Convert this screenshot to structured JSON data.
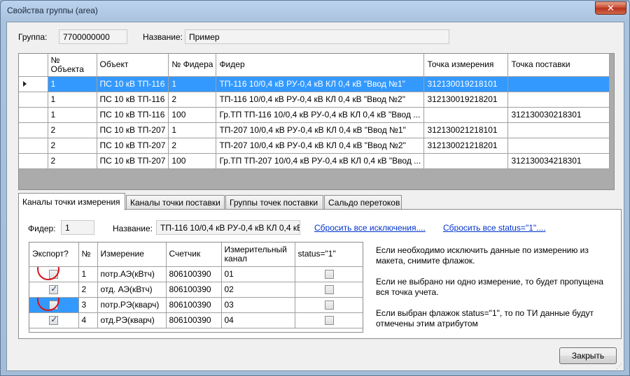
{
  "window": {
    "title": "Свойства группы (area)",
    "close_glyph": "✕"
  },
  "group": {
    "group_label": "Группа:",
    "group_value": "7700000000",
    "name_label": "Название:",
    "name_value": "Пример"
  },
  "main_table": {
    "columns": [
      "№ Объекта",
      "Объект",
      "№ Фидера",
      "Фидер",
      "Точка измерения",
      "Точка поставки"
    ],
    "rows": [
      {
        "n": "1",
        "obj": "ПС 10 кВ ТП-116",
        "fn": "1",
        "feeder": "ТП-116 10/0,4 кВ РУ-0,4 кВ КЛ 0,4 кВ \"Ввод №1\"",
        "tp": "312130019218101",
        "tsp": "",
        "selected": true
      },
      {
        "n": "1",
        "obj": "ПС 10 кВ ТП-116",
        "fn": "2",
        "feeder": "ТП-116 10/0,4 кВ РУ-0,4 кВ КЛ 0,4 кВ \"Ввод №2\"",
        "tp": "312130019218201",
        "tsp": ""
      },
      {
        "n": "1",
        "obj": "ПС 10 кВ ТП-116",
        "fn": "100",
        "feeder": "Гр.ТП ТП-116 10/0,4 кВ РУ-0,4 кВ КЛ 0,4 кВ \"Ввод ...",
        "tp": "",
        "tsp": "312130030218301"
      },
      {
        "n": "2",
        "obj": "ПС 10 кВ ТП-207",
        "fn": "1",
        "feeder": "ТП-207 10/0,4 кВ РУ-0,4 кВ КЛ 0,4 кВ \"Ввод №1\"",
        "tp": "312130021218101",
        "tsp": ""
      },
      {
        "n": "2",
        "obj": "ПС 10 кВ ТП-207",
        "fn": "2",
        "feeder": "ТП-207 10/0,4 кВ РУ-0,4 кВ КЛ 0,4 кВ \"Ввод №2\"",
        "tp": "312130021218201",
        "tsp": ""
      },
      {
        "n": "2",
        "obj": "ПС 10 кВ ТП-207",
        "fn": "100",
        "feeder": "Гр.ТП ТП-207 10/0,4 кВ РУ-0,4 кВ КЛ 0,4 кВ \"Ввод ...",
        "tp": "",
        "tsp": "312130034218301"
      }
    ]
  },
  "tabs": [
    "Каналы точки измерения",
    "Каналы точки поставки",
    "Группы точек поставки",
    "Сальдо перетоков"
  ],
  "tab_panel": {
    "feeder_label": "Фидер:",
    "feeder_value": "1",
    "name_label": "Название:",
    "name_value": "ТП-116 10/0,4 кВ РУ-0,4 кВ КЛ 0,4 кВ",
    "reset_exclusions": "Сбросить все исключения....",
    "reset_status": "Сбросить все status=\"1\"....",
    "channels_columns": [
      "Экспорт?",
      "№",
      "Измерение",
      "Счетчик",
      "Измерительный канал",
      "status=\"1\""
    ],
    "channels": [
      {
        "export": false,
        "n": "1",
        "meas": "потр.АЭ(кВтч)",
        "meter": "806100390",
        "channel": "01",
        "status": false
      },
      {
        "export": true,
        "n": "2",
        "meas": "отд. АЭ(кВтч)",
        "meter": "806100390",
        "channel": "02",
        "status": false
      },
      {
        "export": false,
        "n": "3",
        "meas": "потр.РЭ(кварч)",
        "meter": "806100390",
        "channel": "03",
        "status": false
      },
      {
        "export": true,
        "n": "4",
        "meas": "отд.РЭ(кварч)",
        "meter": "806100390",
        "channel": "04",
        "status": false
      }
    ],
    "info": [
      "Если необходимо исключить данные по измерению из макета, снимите флажок.",
      "Если не выбрано ни одно измерение, то будет пропущена вся точка учета.",
      "Если выбран флажок status=\"1\", то по ТИ данные будут отмечены этим атрибутом"
    ]
  },
  "buttons": {
    "close": "Закрыть"
  }
}
